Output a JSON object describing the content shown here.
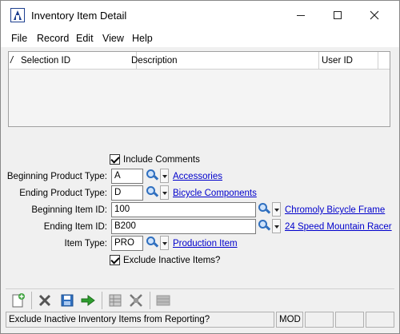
{
  "window": {
    "title": "Inventory Item Detail"
  },
  "menu": [
    "File",
    "Record",
    "Edit",
    "View",
    "Help"
  ],
  "grid": {
    "sort_indicator": "/",
    "columns": [
      "Selection ID",
      "Description",
      "User ID"
    ]
  },
  "form": {
    "include_comments": {
      "label": "Include Comments",
      "checked": true
    },
    "beginning_product_type": {
      "label": "Beginning Product Type:",
      "value": "A",
      "link": "Accessories"
    },
    "ending_product_type": {
      "label": "Ending Product Type:",
      "value": "D",
      "link": "Bicycle Components"
    },
    "beginning_item_id": {
      "label": "Beginning Item ID:",
      "value": "100",
      "link": "Chromoly Bicycle Frame"
    },
    "ending_item_id": {
      "label": "Ending Item ID:",
      "value": "B200",
      "link": "24 Speed Mountain Racer"
    },
    "item_type": {
      "label": "Item Type:",
      "value": "PRO",
      "link": "Production Item"
    },
    "exclude_inactive": {
      "label": "Exclude Inactive Items?",
      "checked": true
    }
  },
  "toolbar": {
    "icons": [
      "new-icon",
      "delete-icon",
      "save-icon",
      "go-icon",
      "grid-icon",
      "fit-icon",
      "list-icon"
    ]
  },
  "status": {
    "message": "Exclude Inactive Inventory Items from Reporting?",
    "mode": "MOD"
  },
  "colors": {
    "link": "#0000cc",
    "accent": "#1d3f8f",
    "lookup": "#2f6fbf",
    "go": "#2e9e2e",
    "delete": "#555555"
  }
}
